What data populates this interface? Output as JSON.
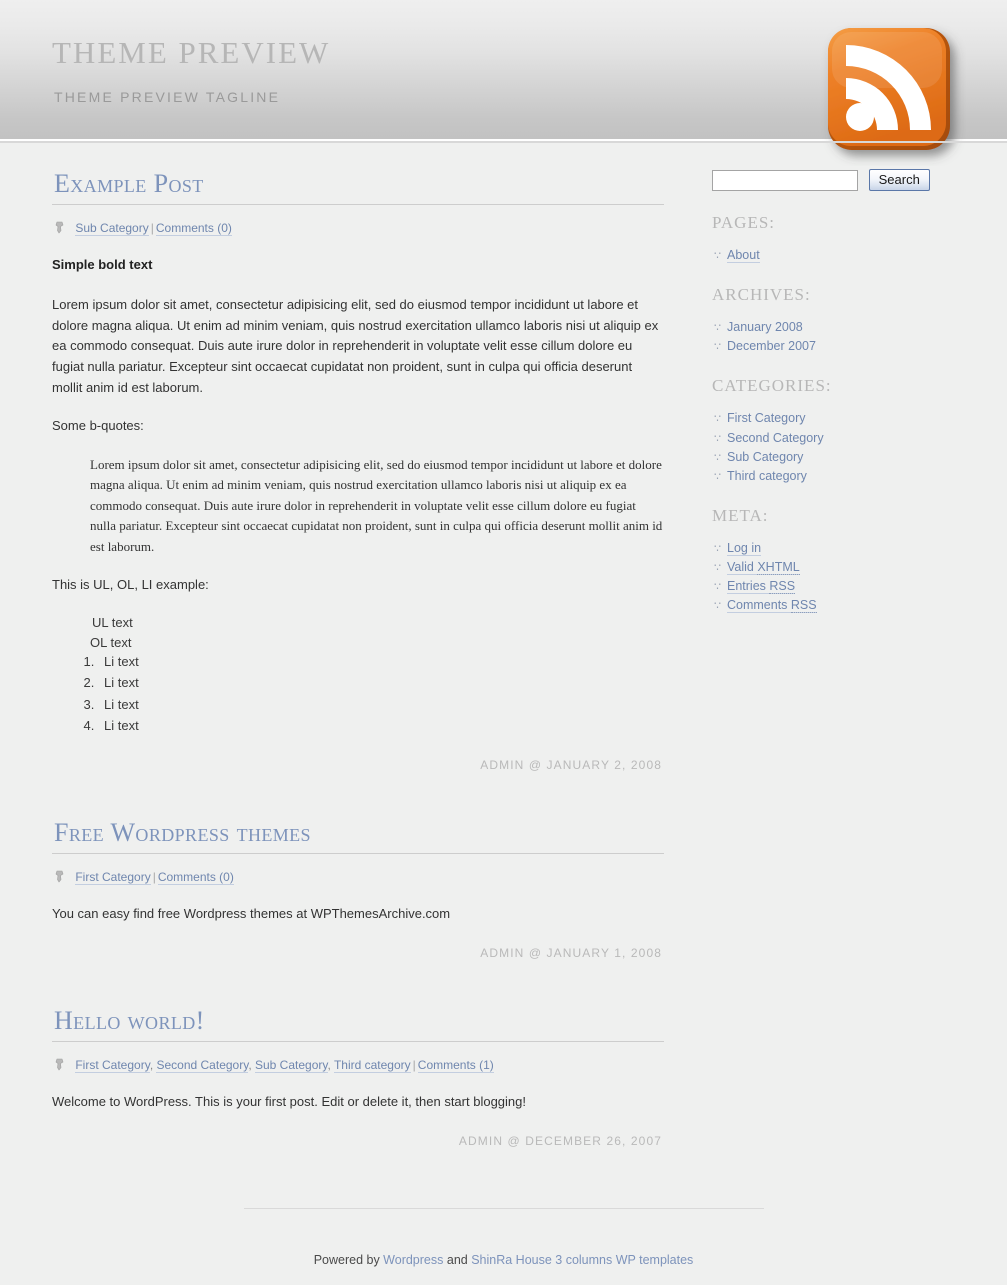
{
  "header": {
    "title": "THEME PREVIEW",
    "tagline": "THEME PREVIEW TAGLINE",
    "rss_icon_name": "rss-feed-icon",
    "rss_color": "#ef7f28"
  },
  "theme": {
    "page_background": "#eff0ef",
    "link_color": "#6f86ae",
    "heading_color": "#7d93bb",
    "muted_color": "#b7b7b7"
  },
  "posts": [
    {
      "title": "Example Post",
      "meta": {
        "icon": "post-meta-icon",
        "categories": [
          "Sub Category"
        ],
        "separator": "|",
        "comments": "Comments (0)"
      },
      "bold_line": "Simple bold text",
      "paragraph1": "Lorem ipsum dolor sit amet, consectetur adipisicing elit, sed do eiusmod tempor incididunt ut labore et dolore magna aliqua. Ut enim ad minim veniam, quis nostrud exercitation ullamco laboris nisi ut aliquip ex ea commodo consequat. Duis aute irure dolor in reprehenderit in voluptate velit esse cillum dolore eu fugiat nulla pariatur. Excepteur sint occaecat cupidatat non proident, sunt in culpa qui officia deserunt mollit anim id est laborum.",
      "quote_intro": "Some b-quotes:",
      "blockquote": "Lorem ipsum dolor sit amet, consectetur adipisicing elit, sed do eiusmod tempor incididunt ut labore et dolore magna aliqua. Ut enim ad minim veniam, quis nostrud exercitation ullamco laboris nisi ut aliquip ex ea commodo consequat. Duis aute irure dolor in reprehenderit in voluptate velit esse cillum dolore eu fugiat nulla pariatur. Excepteur sint occaecat cupidatat non proident, sunt in culpa qui officia deserunt mollit anim id est laborum.",
      "list_intro": "This is UL, OL, LI example:",
      "ul_text": "UL text",
      "ol_text": "OL text",
      "ol_items": [
        "Li text",
        "Li text",
        "Li text",
        "Li text"
      ],
      "byline": "ADMIN @ JANUARY 2, 2008"
    },
    {
      "title": "Free Wordpress themes",
      "meta": {
        "icon": "post-meta-icon",
        "categories": [
          "First Category"
        ],
        "separator": "|",
        "comments": "Comments (0)"
      },
      "paragraph1": "You can easy find free Wordpress themes at WPThemesArchive.com",
      "byline": "ADMIN @ JANUARY 1, 2008"
    },
    {
      "title": "Hello world!",
      "meta": {
        "icon": "post-meta-icon",
        "categories": [
          "First Category",
          "Second Category",
          "Sub Category",
          "Third category"
        ],
        "separator": "|",
        "comments": "Comments (1)"
      },
      "paragraph1": "Welcome to WordPress. This is your first post. Edit or delete it, then start blogging!",
      "byline": "ADMIN @ DECEMBER 26, 2007"
    }
  ],
  "sidebar": {
    "search": {
      "value": "",
      "placeholder": "",
      "button_label": "Search"
    },
    "blocks": [
      {
        "heading": "PAGES:",
        "items": [
          {
            "label": "About",
            "underline": true
          }
        ]
      },
      {
        "heading": "ARCHIVES:",
        "items": [
          {
            "label": "January 2008",
            "underline": false
          },
          {
            "label": "December 2007",
            "underline": false
          }
        ]
      },
      {
        "heading": "CATEGORIES:",
        "items": [
          {
            "label": "First Category",
            "underline": false
          },
          {
            "label": "Second Category",
            "underline": false
          },
          {
            "label": "Sub Category",
            "underline": false
          },
          {
            "label": "Third category",
            "underline": false
          }
        ]
      },
      {
        "heading": "META:",
        "items": [
          {
            "label": "Log in",
            "underline": true
          },
          {
            "label": "Valid ",
            "abbr": "XHTML",
            "underline": true
          },
          {
            "label": "Entries ",
            "abbr": "RSS",
            "underline": true
          },
          {
            "label": "Comments ",
            "abbr": "RSS",
            "underline": true
          }
        ]
      }
    ],
    "bullet_glyph": "∵"
  },
  "footer": {
    "prefix": "Powered by ",
    "link1": "Wordpress",
    "middle": " and ",
    "link2": "ShinRa House 3 columns WP templates"
  }
}
